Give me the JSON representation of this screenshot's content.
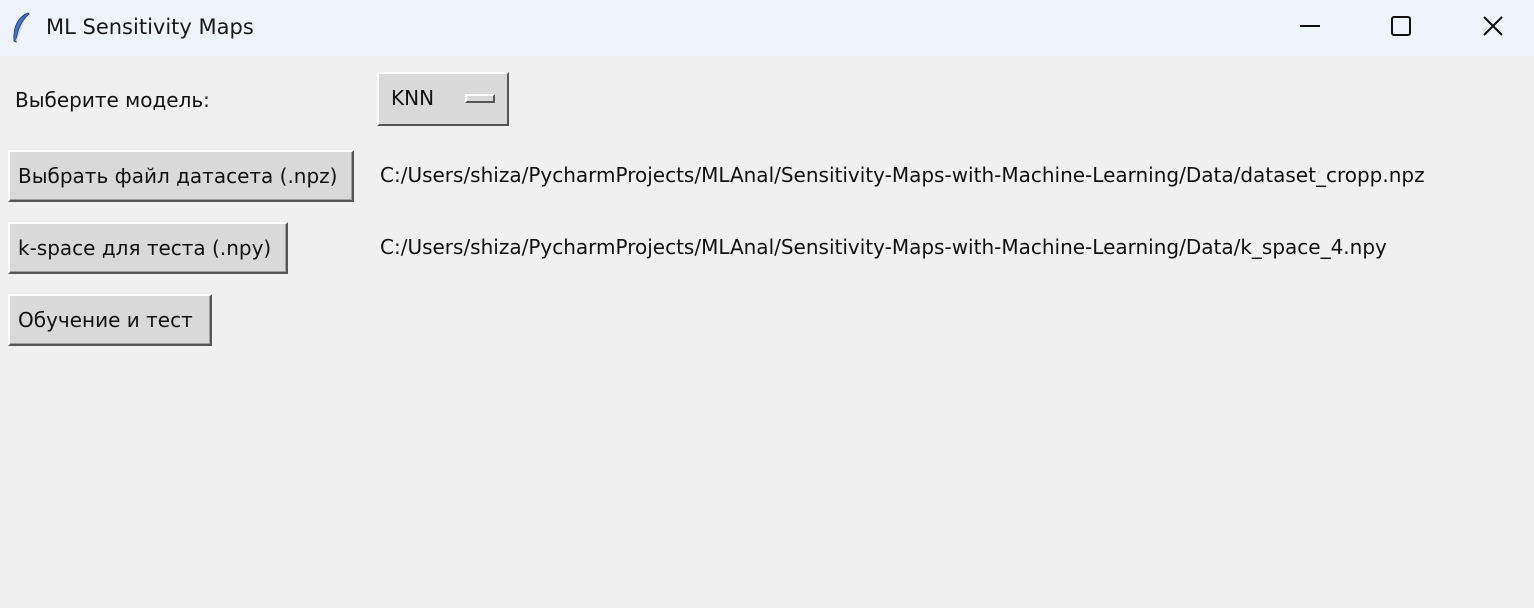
{
  "window": {
    "title": "ML Sensitivity Maps",
    "icon": "feather-icon",
    "controls": [
      "minimize-icon",
      "maximize-icon",
      "close-icon"
    ]
  },
  "model_row": {
    "label": "Выберите модель:",
    "selected_model": "KNN"
  },
  "dataset_row": {
    "button_label": "Выбрать файл датасета (.npz)",
    "path": "C:/Users/shiza/PycharmProjects/MLAnal/Sensitivity-Maps-with-Machine-Learning/Data/dataset_cropp.npz"
  },
  "kspace_row": {
    "button_label": "k-space для теста (.npy)",
    "path": "C:/Users/shiza/PycharmProjects/MLAnal/Sensitivity-Maps-with-Machine-Learning/Data/k_space_4.npy"
  },
  "train_row": {
    "button_label": "Обучение и тест"
  },
  "colors": {
    "window_bg": "#f0f0f0",
    "titlebar_bg": "#eff3fa",
    "button_bg": "#d9d9d9"
  }
}
